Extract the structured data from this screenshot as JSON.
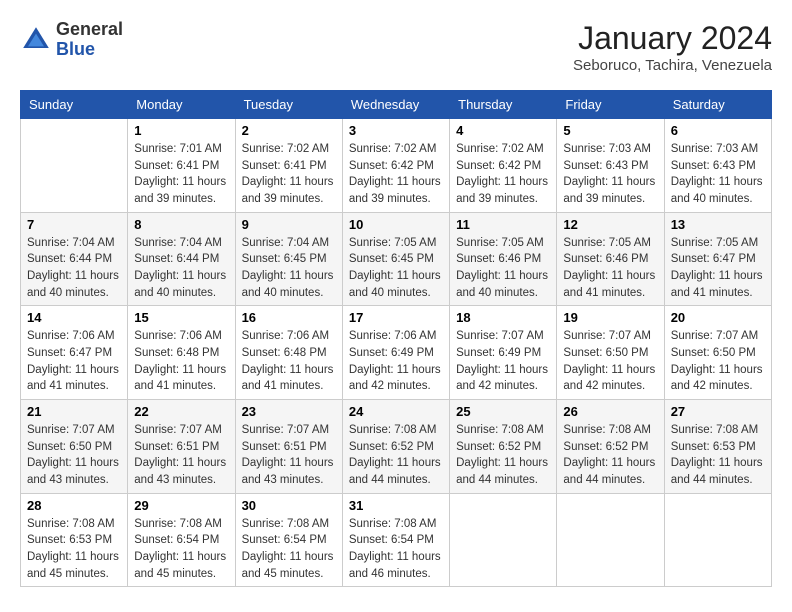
{
  "header": {
    "logo_general": "General",
    "logo_blue": "Blue",
    "month_year": "January 2024",
    "location": "Seboruco, Tachira, Venezuela"
  },
  "days_of_week": [
    "Sunday",
    "Monday",
    "Tuesday",
    "Wednesday",
    "Thursday",
    "Friday",
    "Saturday"
  ],
  "weeks": [
    [
      {
        "day": "",
        "sunrise": "",
        "sunset": "",
        "daylight": ""
      },
      {
        "day": "1",
        "sunrise": "7:01 AM",
        "sunset": "6:41 PM",
        "daylight": "11 hours and 39 minutes."
      },
      {
        "day": "2",
        "sunrise": "7:02 AM",
        "sunset": "6:41 PM",
        "daylight": "11 hours and 39 minutes."
      },
      {
        "day": "3",
        "sunrise": "7:02 AM",
        "sunset": "6:42 PM",
        "daylight": "11 hours and 39 minutes."
      },
      {
        "day": "4",
        "sunrise": "7:02 AM",
        "sunset": "6:42 PM",
        "daylight": "11 hours and 39 minutes."
      },
      {
        "day": "5",
        "sunrise": "7:03 AM",
        "sunset": "6:43 PM",
        "daylight": "11 hours and 39 minutes."
      },
      {
        "day": "6",
        "sunrise": "7:03 AM",
        "sunset": "6:43 PM",
        "daylight": "11 hours and 40 minutes."
      }
    ],
    [
      {
        "day": "7",
        "sunrise": "7:04 AM",
        "sunset": "6:44 PM",
        "daylight": "11 hours and 40 minutes."
      },
      {
        "day": "8",
        "sunrise": "7:04 AM",
        "sunset": "6:44 PM",
        "daylight": "11 hours and 40 minutes."
      },
      {
        "day": "9",
        "sunrise": "7:04 AM",
        "sunset": "6:45 PM",
        "daylight": "11 hours and 40 minutes."
      },
      {
        "day": "10",
        "sunrise": "7:05 AM",
        "sunset": "6:45 PM",
        "daylight": "11 hours and 40 minutes."
      },
      {
        "day": "11",
        "sunrise": "7:05 AM",
        "sunset": "6:46 PM",
        "daylight": "11 hours and 40 minutes."
      },
      {
        "day": "12",
        "sunrise": "7:05 AM",
        "sunset": "6:46 PM",
        "daylight": "11 hours and 41 minutes."
      },
      {
        "day": "13",
        "sunrise": "7:05 AM",
        "sunset": "6:47 PM",
        "daylight": "11 hours and 41 minutes."
      }
    ],
    [
      {
        "day": "14",
        "sunrise": "7:06 AM",
        "sunset": "6:47 PM",
        "daylight": "11 hours and 41 minutes."
      },
      {
        "day": "15",
        "sunrise": "7:06 AM",
        "sunset": "6:48 PM",
        "daylight": "11 hours and 41 minutes."
      },
      {
        "day": "16",
        "sunrise": "7:06 AM",
        "sunset": "6:48 PM",
        "daylight": "11 hours and 41 minutes."
      },
      {
        "day": "17",
        "sunrise": "7:06 AM",
        "sunset": "6:49 PM",
        "daylight": "11 hours and 42 minutes."
      },
      {
        "day": "18",
        "sunrise": "7:07 AM",
        "sunset": "6:49 PM",
        "daylight": "11 hours and 42 minutes."
      },
      {
        "day": "19",
        "sunrise": "7:07 AM",
        "sunset": "6:50 PM",
        "daylight": "11 hours and 42 minutes."
      },
      {
        "day": "20",
        "sunrise": "7:07 AM",
        "sunset": "6:50 PM",
        "daylight": "11 hours and 42 minutes."
      }
    ],
    [
      {
        "day": "21",
        "sunrise": "7:07 AM",
        "sunset": "6:50 PM",
        "daylight": "11 hours and 43 minutes."
      },
      {
        "day": "22",
        "sunrise": "7:07 AM",
        "sunset": "6:51 PM",
        "daylight": "11 hours and 43 minutes."
      },
      {
        "day": "23",
        "sunrise": "7:07 AM",
        "sunset": "6:51 PM",
        "daylight": "11 hours and 43 minutes."
      },
      {
        "day": "24",
        "sunrise": "7:08 AM",
        "sunset": "6:52 PM",
        "daylight": "11 hours and 44 minutes."
      },
      {
        "day": "25",
        "sunrise": "7:08 AM",
        "sunset": "6:52 PM",
        "daylight": "11 hours and 44 minutes."
      },
      {
        "day": "26",
        "sunrise": "7:08 AM",
        "sunset": "6:52 PM",
        "daylight": "11 hours and 44 minutes."
      },
      {
        "day": "27",
        "sunrise": "7:08 AM",
        "sunset": "6:53 PM",
        "daylight": "11 hours and 44 minutes."
      }
    ],
    [
      {
        "day": "28",
        "sunrise": "7:08 AM",
        "sunset": "6:53 PM",
        "daylight": "11 hours and 45 minutes."
      },
      {
        "day": "29",
        "sunrise": "7:08 AM",
        "sunset": "6:54 PM",
        "daylight": "11 hours and 45 minutes."
      },
      {
        "day": "30",
        "sunrise": "7:08 AM",
        "sunset": "6:54 PM",
        "daylight": "11 hours and 45 minutes."
      },
      {
        "day": "31",
        "sunrise": "7:08 AM",
        "sunset": "6:54 PM",
        "daylight": "11 hours and 46 minutes."
      },
      {
        "day": "",
        "sunrise": "",
        "sunset": "",
        "daylight": ""
      },
      {
        "day": "",
        "sunrise": "",
        "sunset": "",
        "daylight": ""
      },
      {
        "day": "",
        "sunrise": "",
        "sunset": "",
        "daylight": ""
      }
    ]
  ]
}
